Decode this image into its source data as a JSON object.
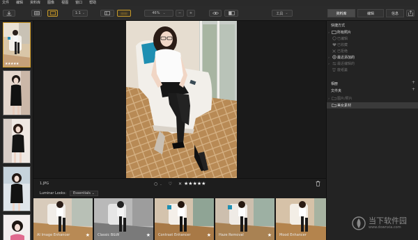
{
  "menu": [
    "文件",
    "编辑",
    "资料库",
    "图像",
    "视图",
    "窗口",
    "帮助"
  ],
  "toolbar": {
    "zoom_fit": "1:1",
    "zoom_value": "46%",
    "tools_label": "工具",
    "library_tab": "资料库",
    "edit_tab": "编辑",
    "info_tab": "信息"
  },
  "filmstrip": {
    "selected_rating": "★★★★★"
  },
  "center": {
    "filename": "1.JPG",
    "rating_stars": "★★★★★",
    "rating_reject": "✕",
    "flag_symbol": "○",
    "heart_symbol": "♡"
  },
  "looks": {
    "label": "Luminar Looks:",
    "category": "Essentials ⌄",
    "items": [
      {
        "name": "AI Image Enhancer"
      },
      {
        "name": "Classic B&W"
      },
      {
        "name": "Contrast Enhancer"
      },
      {
        "name": "Haze Removal"
      },
      {
        "name": "Mood Enhancer"
      }
    ]
  },
  "sidebar": {
    "shortcuts_header": "快捷方式",
    "all_photos": "所有照片",
    "edited": "已编辑",
    "favorites": "已收藏",
    "rejected": "已拒绝",
    "recently_added": "最近添加的",
    "recently_edited": "最近编辑的",
    "trash": "废纸篓",
    "albums_header": "相册",
    "folders_header": "文件夹",
    "pictures_folder": "图片/照片",
    "beauty_folder": "美女素材"
  },
  "watermark": {
    "title": "当下软件园",
    "url": "www.downxia.com"
  }
}
